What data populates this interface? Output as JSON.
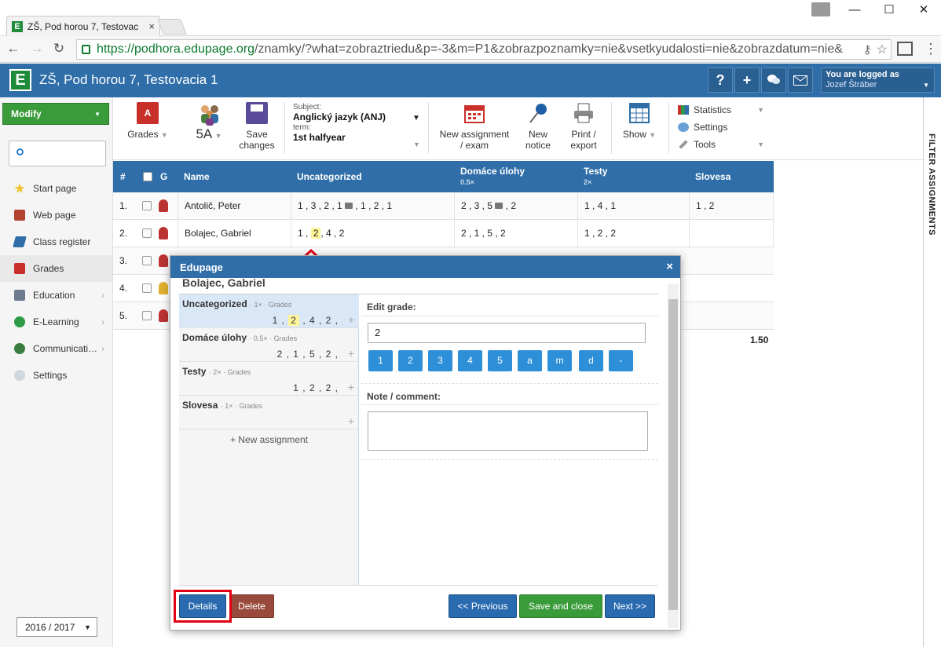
{
  "browser": {
    "tab_title": "ZŠ, Pod horou 7, Testovac",
    "tab_close": "×",
    "url_host": "https://podhora.edupage.org",
    "url_path": "/znamky/?what=zobraztriedu&p=-3&m=P1&zobrazpoznamky=nie&vsetkyudalosti=nie&zobrazdatum=nie&",
    "min": "—",
    "max": "☐",
    "close": "✕"
  },
  "header": {
    "logo": "E",
    "school": "ZŠ, Pod horou 7, Testovacia 1",
    "help": "?",
    "add": "+",
    "logged_as": "You are logged as",
    "user": "Jozef Štráber"
  },
  "sidebar": {
    "modify": "Modify",
    "items": [
      {
        "label": "Start page"
      },
      {
        "label": "Web page"
      },
      {
        "label": "Class register"
      },
      {
        "label": "Grades"
      },
      {
        "label": "Education"
      },
      {
        "label": "E-Learning"
      },
      {
        "label": "Communicati…"
      },
      {
        "label": "Settings"
      }
    ],
    "year": "2016 / 2017"
  },
  "toolbar": {
    "grades": "Grades",
    "class": "5A",
    "save1": "Save",
    "save2": "changes",
    "subject_label": "Subject:",
    "subject": "Anglický jazyk (ANJ)",
    "term_label": "term:",
    "term": "1st halfyear",
    "newasg1": "New assignment",
    "newasg2": "/ exam",
    "newnotice1": "New",
    "newnotice2": "notice",
    "print1": "Print /",
    "print2": "export",
    "show": "Show",
    "statistics": "Statistics",
    "settings": "Settings",
    "tools": "Tools"
  },
  "filter": "FILTER ASSIGNMENTS",
  "grid": {
    "headers": {
      "num": "#",
      "g": "G",
      "name": "Name",
      "uncat": "Uncategorized",
      "du": "Domáce úlohy",
      "du_w": "0.5×",
      "testy": "Testy",
      "testy_w": "2×",
      "slovesa": "Slovesa"
    },
    "rows": [
      {
        "n": "1.",
        "name": "Antolič, Peter",
        "uncat": "1 , 3 , 2 , 1",
        "uncat2": ", 1 , 2 , 1",
        "du": "2 , 3 , 5",
        "du2": ", 2",
        "testy": "1 , 4 , 1",
        "slovesa": "1 , 2"
      },
      {
        "n": "2.",
        "name": "Bolajec, Gabriel",
        "uncat_a": "1 ,",
        "uncat_b": "2",
        "uncat_c": ", 4 , 2",
        "du": "2 , 1 , 5 , 2",
        "testy": "1 , 2 , 2",
        "slovesa": ""
      },
      {
        "n": "3."
      },
      {
        "n": "4."
      },
      {
        "n": "5."
      }
    ],
    "avg": "1.50"
  },
  "dialog": {
    "title": "Edupage",
    "close": "×",
    "student": "Bolajec, Gabriel",
    "assignments": [
      {
        "name": "Uncategorized",
        "meta": "· 1× · Grades",
        "g1": "1 ,",
        "g2": "2",
        "g3": ", 4 , 2 ,"
      },
      {
        "name": "Domáce úlohy",
        "meta": "· 0.5× · Grades",
        "grades": "2 , 1 , 5 , 2 ,"
      },
      {
        "name": "Testy",
        "meta": "· 2× · Grades",
        "grades": "1 , 2 , 2 ,"
      },
      {
        "name": "Slovesa",
        "meta": "· 1× · Grades",
        "grades": ""
      }
    ],
    "plus": "+",
    "new_assignment": "+ New assignment",
    "edit_label": "Edit grade:",
    "grade_value": "2",
    "grade_buttons": [
      "1",
      "2",
      "3",
      "4",
      "5",
      "a",
      "m",
      "d",
      "-"
    ],
    "note_label": "Note / comment:",
    "details": "Details",
    "delete": "Delete",
    "previous": "<< Previous",
    "save_close": "Save and close",
    "next": "Next >>"
  }
}
